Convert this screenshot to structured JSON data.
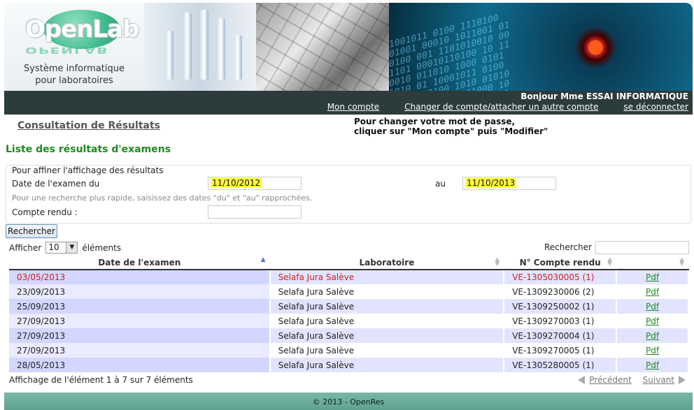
{
  "banner": {
    "logo_text": "OpenLab",
    "logo_reflection": "OPENLAB",
    "subtitle_line1": "Système informatique",
    "subtitle_line2": "pour laboratoires",
    "binary_text": "1001011 0100 1110100\n01001 00010 1011001 01\n0100 001 1101010010 00\n1101 00010110100 10 11\n0010 011010 1000 0101\n1010 01 10001011 0100\n011010 0100 1010 01010\n10 0100 10110 01000 10\n0011 01010 0100101 001\n1100101 00100 1011"
  },
  "header": {
    "greeting": "Bonjour Mme ESSAI INFORMATIQUE",
    "links": [
      "Mon compte",
      "Changer de compte/attacher un autre compte",
      "se déconnecter"
    ]
  },
  "page": {
    "title": "Consultation de Résultats",
    "note_line1": "Pour changer votre mot de passe,",
    "note_line2": "cliquer sur \"Mon compte\" puis \"Modifier\"",
    "list_title": "Liste des résultats d'examens"
  },
  "filter": {
    "legend": "Pour affiner l'affichage des résultats",
    "date_label": "Date de l'examen du",
    "date_from": "11/10/2012",
    "to_label": "au",
    "date_to": "11/10/2013",
    "hint": "Pour une recherche plus rapide, saisissez des dates \"du\" et \"au\" rapprochées.",
    "report_label": "Compte rendu :",
    "report_value": ""
  },
  "search_button": "Rechercher",
  "table_controls": {
    "show_label": "Afficher",
    "page_size": "10",
    "elements_label": "éléments",
    "search_label": "Rechercher :",
    "search_value": ""
  },
  "table": {
    "columns": [
      "Date de l'examen",
      "Laboratoire",
      "N° Compte rendu",
      ""
    ],
    "rows": [
      {
        "date": "03/05/2013",
        "lab": "Selafa Jura Salève",
        "report": "VE-1305030005 (1)",
        "pdf": "Pdf"
      },
      {
        "date": "23/09/2013",
        "lab": "Selafa Jura Salève",
        "report": "VE-1309230006 (2)",
        "pdf": "Pdf"
      },
      {
        "date": "25/09/2013",
        "lab": "Selafa Jura Salève",
        "report": "VE-1309250002 (1)",
        "pdf": "Pdf"
      },
      {
        "date": "27/09/2013",
        "lab": "Selafa Jura Salève",
        "report": "VE-1309270003 (1)",
        "pdf": "Pdf"
      },
      {
        "date": "27/09/2013",
        "lab": "Selafa Jura Salève",
        "report": "VE-1309270004 (1)",
        "pdf": "Pdf"
      },
      {
        "date": "27/09/2013",
        "lab": "Selafa Jura Salève",
        "report": "VE-1309270005 (1)",
        "pdf": "Pdf"
      },
      {
        "date": "28/05/2013",
        "lab": "Selafa Jura Salève",
        "report": "VE-1305280005 (1)",
        "pdf": "Pdf"
      }
    ]
  },
  "pagination": {
    "info": "Affichage de l'élément 1 à 7 sur 7 éléments",
    "prev": "Précédent",
    "next": "Suivant"
  },
  "footer": "© 2013 - OpenRes",
  "colors": {
    "accent_green": "#1e8a1e",
    "navbar": "#2c3b3b",
    "highlight": "#ffff33",
    "alert_red": "#d0201f",
    "row_odd": "#e2e4ff"
  }
}
